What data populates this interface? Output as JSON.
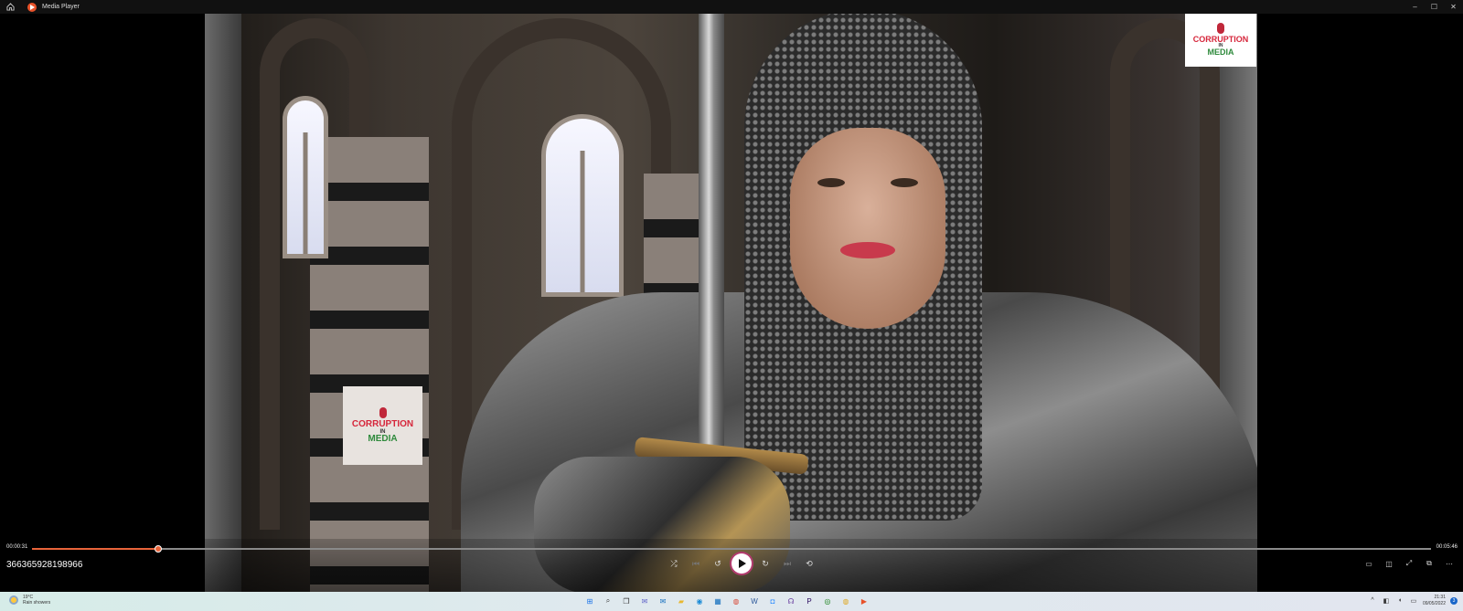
{
  "window": {
    "title": "Media Player",
    "controls": {
      "minimize": "–",
      "maximize": "☐",
      "close": "✕"
    }
  },
  "video": {
    "watermark": {
      "line1": "CORRUPTION",
      "line2": "IN",
      "line3": "MEDIA"
    }
  },
  "player": {
    "current_time": "00:00:31",
    "duration": "00:05:46",
    "progress_fraction": 0.09,
    "media_title": "366365928198966",
    "accent_color": "#e8643a",
    "buttons": {
      "shuffle": "⤮",
      "previous": "⏮",
      "rewind": "↺",
      "forward": "↻",
      "next": "⏭",
      "repeat": "⟲"
    },
    "right_buttons": {
      "captions": "▭",
      "audio": "◫",
      "fullscreen": "⤢",
      "miniplayer": "⧉",
      "more": "⋯"
    }
  },
  "taskbar": {
    "weather_temp": "19°C",
    "weather_desc": "Rain showers",
    "apps": [
      {
        "icon": "windows-start-icon",
        "glyph": "⊞",
        "color": "#1a73e8"
      },
      {
        "icon": "search-icon",
        "glyph": "⌕",
        "color": "#333"
      },
      {
        "icon": "task-view-icon",
        "glyph": "❐",
        "color": "#333"
      },
      {
        "icon": "chat-icon",
        "glyph": "✉",
        "color": "#5b5fc7"
      },
      {
        "icon": "mail-icon",
        "glyph": "✉",
        "color": "#0f6cbd"
      },
      {
        "icon": "file-explorer-icon",
        "glyph": "▰",
        "color": "#e8b830"
      },
      {
        "icon": "edge-icon",
        "glyph": "◉",
        "color": "#1b8bd6"
      },
      {
        "icon": "store-icon",
        "glyph": "▦",
        "color": "#0f6cbd"
      },
      {
        "icon": "chrome-icon",
        "glyph": "◍",
        "color": "#d94a38"
      },
      {
        "icon": "word-icon",
        "glyph": "W",
        "color": "#2b579a"
      },
      {
        "icon": "zoom-icon",
        "glyph": "◘",
        "color": "#2d8cff"
      },
      {
        "icon": "headset-icon",
        "glyph": "☊",
        "color": "#6b3fa0"
      },
      {
        "icon": "premiere-icon",
        "glyph": "P",
        "color": "#2a0a5e"
      },
      {
        "icon": "xbox-icon",
        "glyph": "◎",
        "color": "#107c10"
      },
      {
        "icon": "chrome-canary-icon",
        "glyph": "◍",
        "color": "#e0a823"
      },
      {
        "icon": "media-player-icon",
        "glyph": "▶",
        "color": "#e8522a"
      }
    ],
    "tray": {
      "chevron": "^",
      "time": "21:31",
      "date": "09/05/2022",
      "notifications": "3"
    }
  }
}
